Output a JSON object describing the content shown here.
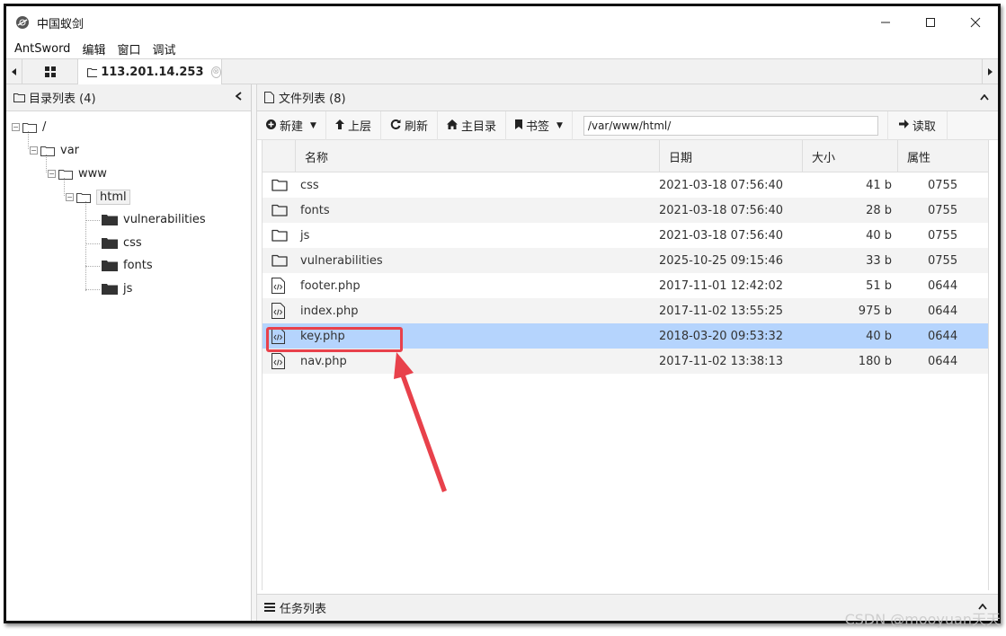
{
  "window": {
    "title": "中国蚁剑",
    "minimize": "—",
    "maximize": "☐",
    "close": "✕"
  },
  "menu": [
    "AntSword",
    "编辑",
    "窗口",
    "调试"
  ],
  "tabs": {
    "active_label": "113.201.14.253",
    "close": "⊗"
  },
  "left_panel": {
    "title": "目录列表 (4)",
    "tree": [
      {
        "label": "/",
        "level": 0
      },
      {
        "label": "var",
        "level": 1
      },
      {
        "label": "www",
        "level": 2
      },
      {
        "label": "html",
        "level": 3,
        "selected": true
      },
      {
        "label": "vulnerabilities",
        "level": 4
      },
      {
        "label": "css",
        "level": 4
      },
      {
        "label": "fonts",
        "level": 4
      },
      {
        "label": "js",
        "level": 4
      }
    ]
  },
  "right_panel": {
    "title": "文件列表 (8)",
    "toolbar": {
      "new": "新建",
      "up": "上层",
      "refresh": "刷新",
      "home": "主目录",
      "bookmark": "书签",
      "path": "/var/www/html/",
      "read": "读取"
    },
    "columns": {
      "name": "名称",
      "date": "日期",
      "size": "大小",
      "attr": "属性"
    },
    "rows": [
      {
        "type": "folder",
        "name": "css",
        "date": "2021-03-18 07:56:40",
        "size": "41 b",
        "attr": "0755"
      },
      {
        "type": "folder",
        "name": "fonts",
        "date": "2021-03-18 07:56:40",
        "size": "28 b",
        "attr": "0755"
      },
      {
        "type": "folder",
        "name": "js",
        "date": "2021-03-18 07:56:40",
        "size": "40 b",
        "attr": "0755"
      },
      {
        "type": "folder",
        "name": "vulnerabilities",
        "date": "2025-10-25 09:15:46",
        "size": "33 b",
        "attr": "0755"
      },
      {
        "type": "code",
        "name": "footer.php",
        "date": "2017-11-01 12:42:02",
        "size": "51 b",
        "attr": "0644"
      },
      {
        "type": "code",
        "name": "index.php",
        "date": "2017-11-02 13:55:25",
        "size": "975 b",
        "attr": "0644"
      },
      {
        "type": "code",
        "name": "key.php",
        "date": "2018-03-20 09:53:32",
        "size": "40 b",
        "attr": "0644",
        "selected": true
      },
      {
        "type": "code",
        "name": "nav.php",
        "date": "2017-11-02 13:38:13",
        "size": "180 b",
        "attr": "0644"
      }
    ]
  },
  "task_panel": {
    "title": "任务列表"
  },
  "watermark": "CSDN @mooyuan天天",
  "colors": {
    "selected_row": "#b5d4fd",
    "annotation": "#e8414b"
  }
}
